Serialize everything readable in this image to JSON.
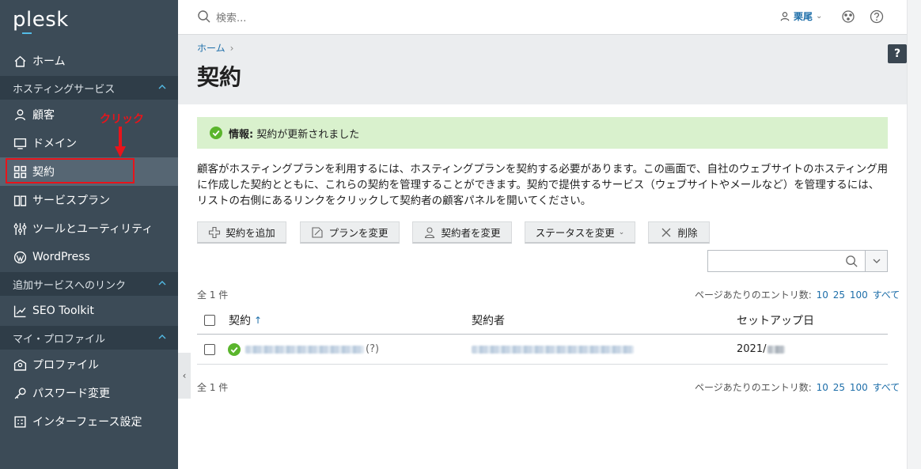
{
  "app": {
    "logo_text": "plesk"
  },
  "sidebar": {
    "home": "ホーム",
    "sections": [
      {
        "title": "ホスティングサービス",
        "items": [
          "顧客",
          "ドメイン",
          "契約",
          "サービスプラン",
          "ツールとユーティリティ",
          "WordPress"
        ]
      },
      {
        "title": "追加サービスへのリンク",
        "items": [
          "SEO Toolkit"
        ]
      },
      {
        "title": "マイ・プロファイル",
        "items": [
          "プロファイル",
          "パスワード変更",
          "インターフェース設定"
        ]
      }
    ],
    "active_item": "契約",
    "annotation": {
      "text": "クリック",
      "color": "#e8141b"
    }
  },
  "topbar": {
    "search_placeholder": "検索...",
    "user_name": "栗尾"
  },
  "page": {
    "breadcrumb": "ホーム",
    "title": "契約",
    "alert": {
      "label": "情報:",
      "message": "契約が更新されました"
    },
    "description": "顧客がホスティングプランを利用するには、ホスティングプランを契約する必要があります。この画面で、自社のウェブサイトのホスティング用に作成した契約とともに、これらの契約を管理することができます。契約で提供するサービス（ウェブサイトやメールなど）を管理するには、リストの右側にあるリンクをクリックして契約者の顧客パネルを開いてください。",
    "help": "?"
  },
  "toolbar": {
    "add": "契約を追加",
    "change_plan": "プランを変更",
    "change_owner": "契約者を変更",
    "change_status": "ステータスを変更",
    "delete": "削除"
  },
  "list": {
    "total": "全 1 件",
    "per_page_label": "ページあたりのエントリ数:",
    "per_page_options": [
      "10",
      "25",
      "100",
      "すべて"
    ],
    "columns": [
      "契約",
      "契約者",
      "セットアップ日"
    ],
    "rows": [
      {
        "subscription_suffix": "(?)",
        "setup_date": "2021/"
      }
    ]
  },
  "colors": {
    "sidebar_bg": "#3c4b57",
    "accent": "#1d6ea9",
    "alert_bg": "#d9f1cd",
    "success": "#5ab52c"
  }
}
